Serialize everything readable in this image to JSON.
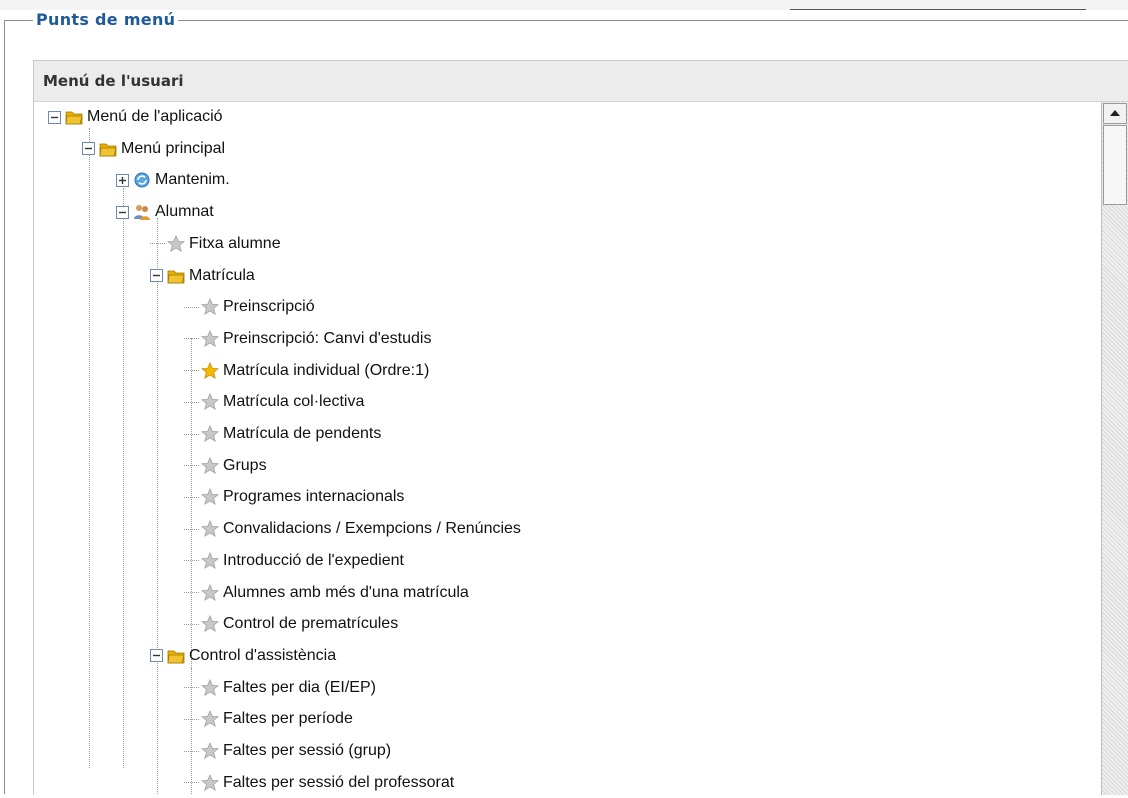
{
  "fieldset": {
    "legend": "Punts de menú"
  },
  "panel": {
    "title": "Menú de l'usuari"
  },
  "tree": [
    {
      "label": "Menú de l'aplicació",
      "icon": "folder-open-icon",
      "expander": "minus"
    },
    {
      "label": "Menú principal",
      "icon": "folder-open-icon",
      "expander": "minus"
    },
    {
      "label": "Mantenim.",
      "icon": "gear-refresh-icon",
      "expander": "plus"
    },
    {
      "label": "Alumnat",
      "icon": "users-icon",
      "expander": "minus"
    },
    {
      "label": "Fitxa alumne",
      "icon": "star-icon",
      "expander": "none"
    },
    {
      "label": "Matrícula",
      "icon": "folder-open-icon",
      "expander": "minus"
    },
    {
      "label": "Preinscripció",
      "icon": "star-icon",
      "expander": "none"
    },
    {
      "label": "Preinscripció: Canvi d'estudis",
      "icon": "star-icon",
      "expander": "none"
    },
    {
      "label": "Matrícula individual (Ordre:1)",
      "icon": "star-gold-icon",
      "expander": "none"
    },
    {
      "label": "Matrícula col·lectiva",
      "icon": "star-icon",
      "expander": "none"
    },
    {
      "label": "Matrícula de pendents",
      "icon": "star-icon",
      "expander": "none"
    },
    {
      "label": "Grups",
      "icon": "star-icon",
      "expander": "none"
    },
    {
      "label": "Programes internacionals",
      "icon": "star-icon",
      "expander": "none"
    },
    {
      "label": "Convalidacions / Exempcions / Renúncies",
      "icon": "star-icon",
      "expander": "none"
    },
    {
      "label": "Introducció de l'expedient",
      "icon": "star-icon",
      "expander": "none"
    },
    {
      "label": "Alumnes amb més d'una matrícula",
      "icon": "star-icon",
      "expander": "none"
    },
    {
      "label": "Control de prematrícules",
      "icon": "star-icon",
      "expander": "none"
    },
    {
      "label": "Control d'assistència",
      "icon": "folder-open-icon",
      "expander": "minus"
    },
    {
      "label": "Faltes per dia (EI/EP)",
      "icon": "star-icon",
      "expander": "none"
    },
    {
      "label": "Faltes per període",
      "icon": "star-icon",
      "expander": "none"
    },
    {
      "label": "Faltes per sessió (grup)",
      "icon": "star-icon",
      "expander": "none"
    },
    {
      "label": "Faltes per sessió del professorat",
      "icon": "star-icon",
      "expander": "none"
    }
  ],
  "colors": {
    "legend": "#1f5b9a",
    "header_bg": "#ececec",
    "star_gold": "#f5b800",
    "star_gray": "#c8c8c8",
    "folder": "#f1c232"
  }
}
